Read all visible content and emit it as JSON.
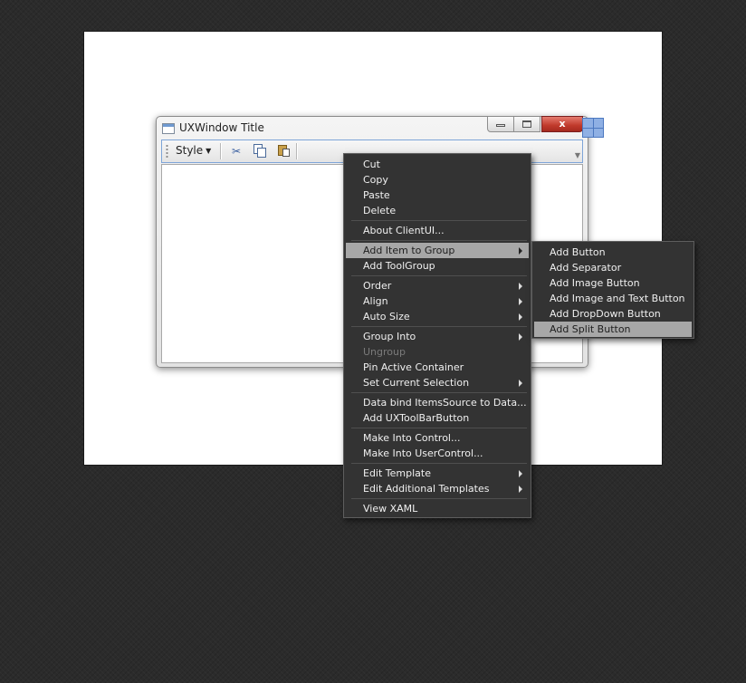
{
  "window": {
    "title": "UXWindow Title",
    "close_glyph": "x",
    "toolbar": {
      "style_label": "Style",
      "icons": [
        "cut-icon",
        "copy-icon",
        "paste-icon"
      ]
    }
  },
  "context_menu": {
    "items": [
      {
        "label": "Cut"
      },
      {
        "label": "Copy"
      },
      {
        "label": "Paste"
      },
      {
        "label": "Delete"
      },
      {
        "label": "About ClientUI..."
      },
      {
        "label": "Add Item to Group",
        "submenu": true,
        "highlighted": true
      },
      {
        "label": "Add ToolGroup"
      },
      {
        "label": "Order",
        "submenu": true
      },
      {
        "label": "Align",
        "submenu": true
      },
      {
        "label": "Auto Size",
        "submenu": true
      },
      {
        "label": "Group Into",
        "submenu": true
      },
      {
        "label": "Ungroup",
        "disabled": true
      },
      {
        "label": "Pin Active Container"
      },
      {
        "label": "Set Current Selection",
        "submenu": true
      },
      {
        "label": "Data bind ItemsSource to Data..."
      },
      {
        "label": "Add UXToolBarButton"
      },
      {
        "label": "Make Into Control..."
      },
      {
        "label": "Make Into UserControl..."
      },
      {
        "label": "Edit Template",
        "submenu": true
      },
      {
        "label": "Edit Additional Templates",
        "submenu": true
      },
      {
        "label": "View XAML"
      }
    ]
  },
  "submenu": {
    "items": [
      {
        "label": "Add Button"
      },
      {
        "label": "Add Separator"
      },
      {
        "label": "Add Image Button"
      },
      {
        "label": "Add Image and Text Button"
      },
      {
        "label": "Add DropDown Button"
      },
      {
        "label": "Add Split Button",
        "highlighted": true
      }
    ]
  },
  "colors": {
    "menu_background": "#333333",
    "menu_highlight": "#a7a7a7",
    "toolbar_border": "#7ea5d8",
    "close_button": "#c0392b"
  }
}
